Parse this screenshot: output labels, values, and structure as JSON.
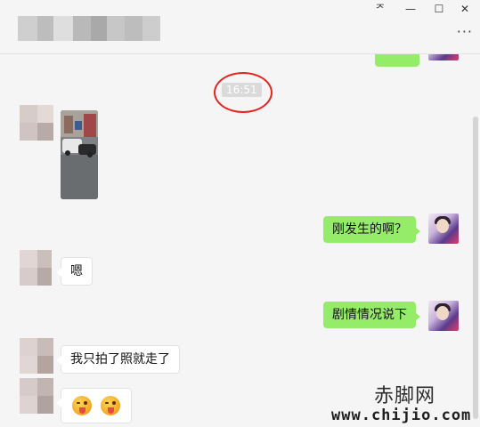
{
  "window": {
    "controls": {
      "pin": "ᅎ",
      "minimize": "—",
      "maximize": "☐",
      "close": "✕"
    },
    "more": "···"
  },
  "chat": {
    "timestamp": "16:51",
    "messages": [
      {
        "from": "me",
        "text": "刚发生的啊？"
      },
      {
        "from": "other",
        "text": "嗯"
      },
      {
        "from": "me",
        "text": "剧情情况说下"
      },
      {
        "from": "other",
        "text": "我只拍了照就走了"
      },
      {
        "from": "other",
        "emoji": [
          "tongue-wink-emoji",
          "tongue-wink-emoji"
        ]
      }
    ],
    "colors": {
      "my_bubble": "#95ec69",
      "other_bubble": "#ffffff",
      "highlight_circle": "#e42323"
    }
  },
  "watermark": {
    "name": "赤脚网",
    "url": "www.chijio.com"
  }
}
